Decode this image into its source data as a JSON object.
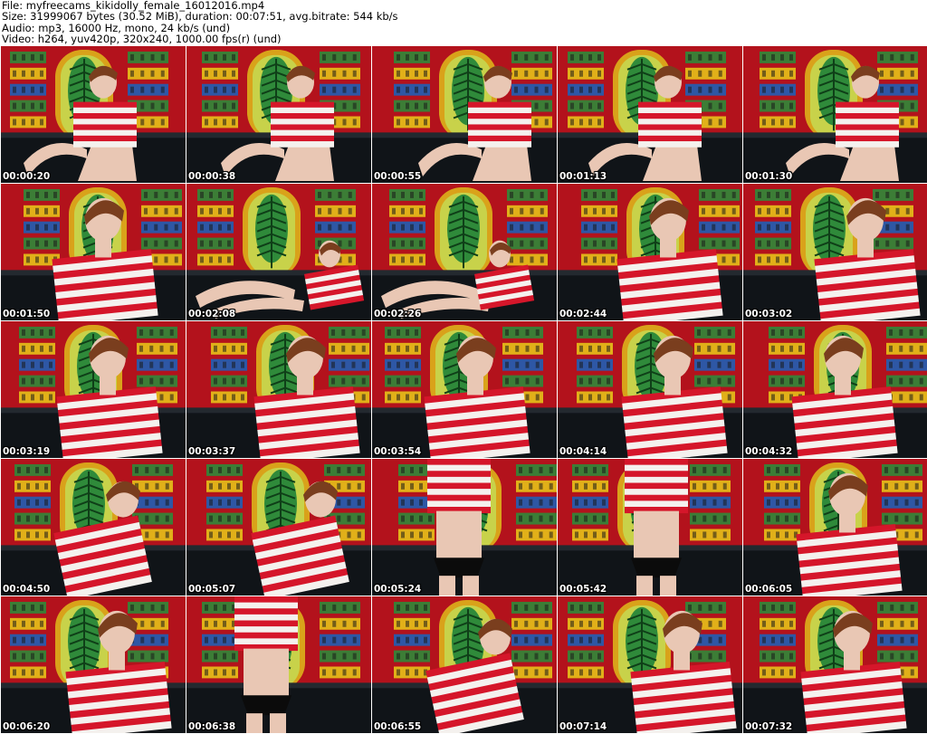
{
  "header": {
    "file_line": "File: myfreecams_kikidolly_female_16012016.mp4",
    "size_line": "Size: 31999067 bytes (30.52 MiB), duration: 00:07:51, avg.bitrate: 544 kb/s",
    "audio_line": "Audio: mp3, 16000 Hz, mono, 24 kb/s (und)",
    "video_line": "Video: h264, yuv420p, 320x240, 1000.00 fps(r) (und)"
  },
  "colors": {
    "tapestry_red": "#b3121c",
    "tapestry_green": "#2f8a3a",
    "tapestry_yellow": "#e6c21a",
    "tapestry_blue": "#1f5fb5",
    "sofa_black": "#101418",
    "stripe_red": "#d5162a",
    "stripe_white": "#f4f1ee",
    "skin": "#e9c7b4",
    "hair": "#7a3e1e"
  },
  "thumbnails": [
    {
      "timestamp": "00:00:20",
      "pose": "sitting"
    },
    {
      "timestamp": "00:00:38",
      "pose": "sitting"
    },
    {
      "timestamp": "00:00:55",
      "pose": "sitting"
    },
    {
      "timestamp": "00:01:13",
      "pose": "sitting"
    },
    {
      "timestamp": "00:01:30",
      "pose": "sitting"
    },
    {
      "timestamp": "00:01:50",
      "pose": "closeup"
    },
    {
      "timestamp": "00:02:08",
      "pose": "lying"
    },
    {
      "timestamp": "00:02:26",
      "pose": "lying"
    },
    {
      "timestamp": "00:02:44",
      "pose": "closeup"
    },
    {
      "timestamp": "00:03:02",
      "pose": "closeup"
    },
    {
      "timestamp": "00:03:19",
      "pose": "closeup"
    },
    {
      "timestamp": "00:03:37",
      "pose": "closeup"
    },
    {
      "timestamp": "00:03:54",
      "pose": "closeup"
    },
    {
      "timestamp": "00:04:14",
      "pose": "closeup"
    },
    {
      "timestamp": "00:04:32",
      "pose": "closeup"
    },
    {
      "timestamp": "00:04:50",
      "pose": "leaning"
    },
    {
      "timestamp": "00:05:07",
      "pose": "leaning"
    },
    {
      "timestamp": "00:05:24",
      "pose": "standing"
    },
    {
      "timestamp": "00:05:42",
      "pose": "standing"
    },
    {
      "timestamp": "00:06:05",
      "pose": "closeup"
    },
    {
      "timestamp": "00:06:20",
      "pose": "closeup"
    },
    {
      "timestamp": "00:06:38",
      "pose": "standing"
    },
    {
      "timestamp": "00:06:55",
      "pose": "leaning"
    },
    {
      "timestamp": "00:07:14",
      "pose": "closeup"
    },
    {
      "timestamp": "00:07:32",
      "pose": "closeup"
    }
  ]
}
